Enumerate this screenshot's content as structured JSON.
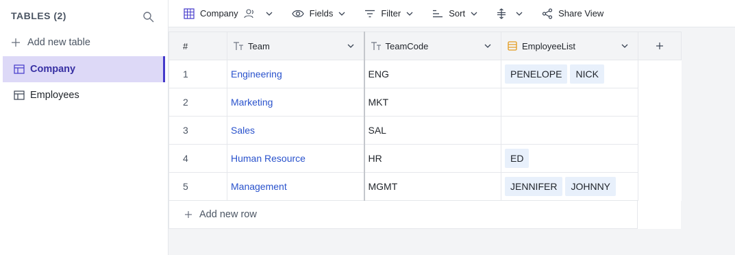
{
  "sidebar": {
    "title": "TABLES (2)",
    "add_label": "Add new table",
    "items": [
      {
        "label": "Company",
        "active": true
      },
      {
        "label": "Employees",
        "active": false
      }
    ]
  },
  "toolbar": {
    "table_label": "Company",
    "fields_label": "Fields",
    "filter_label": "Filter",
    "sort_label": "Sort",
    "share_label": "Share View"
  },
  "grid": {
    "columns": {
      "num": "#",
      "team": "Team",
      "code": "TeamCode",
      "emp": "EmployeeList"
    },
    "rows": [
      {
        "num": "1",
        "team": "Engineering",
        "code": "ENG",
        "employees": [
          "PENELOPE",
          "NICK"
        ]
      },
      {
        "num": "2",
        "team": "Marketing",
        "code": "MKT",
        "employees": []
      },
      {
        "num": "3",
        "team": "Sales",
        "code": "SAL",
        "employees": []
      },
      {
        "num": "4",
        "team": "Human Resource",
        "code": "HR",
        "employees": [
          "ED"
        ]
      },
      {
        "num": "5",
        "team": "Management",
        "code": "MGMT",
        "employees": [
          "JENNIFER",
          "JOHNNY"
        ]
      }
    ],
    "add_row_label": "Add new row"
  },
  "colors": {
    "accent": "#4338ca",
    "active_bg": "#ddd9f7",
    "link": "#2952cc",
    "chip_bg": "#e8f0fb"
  }
}
